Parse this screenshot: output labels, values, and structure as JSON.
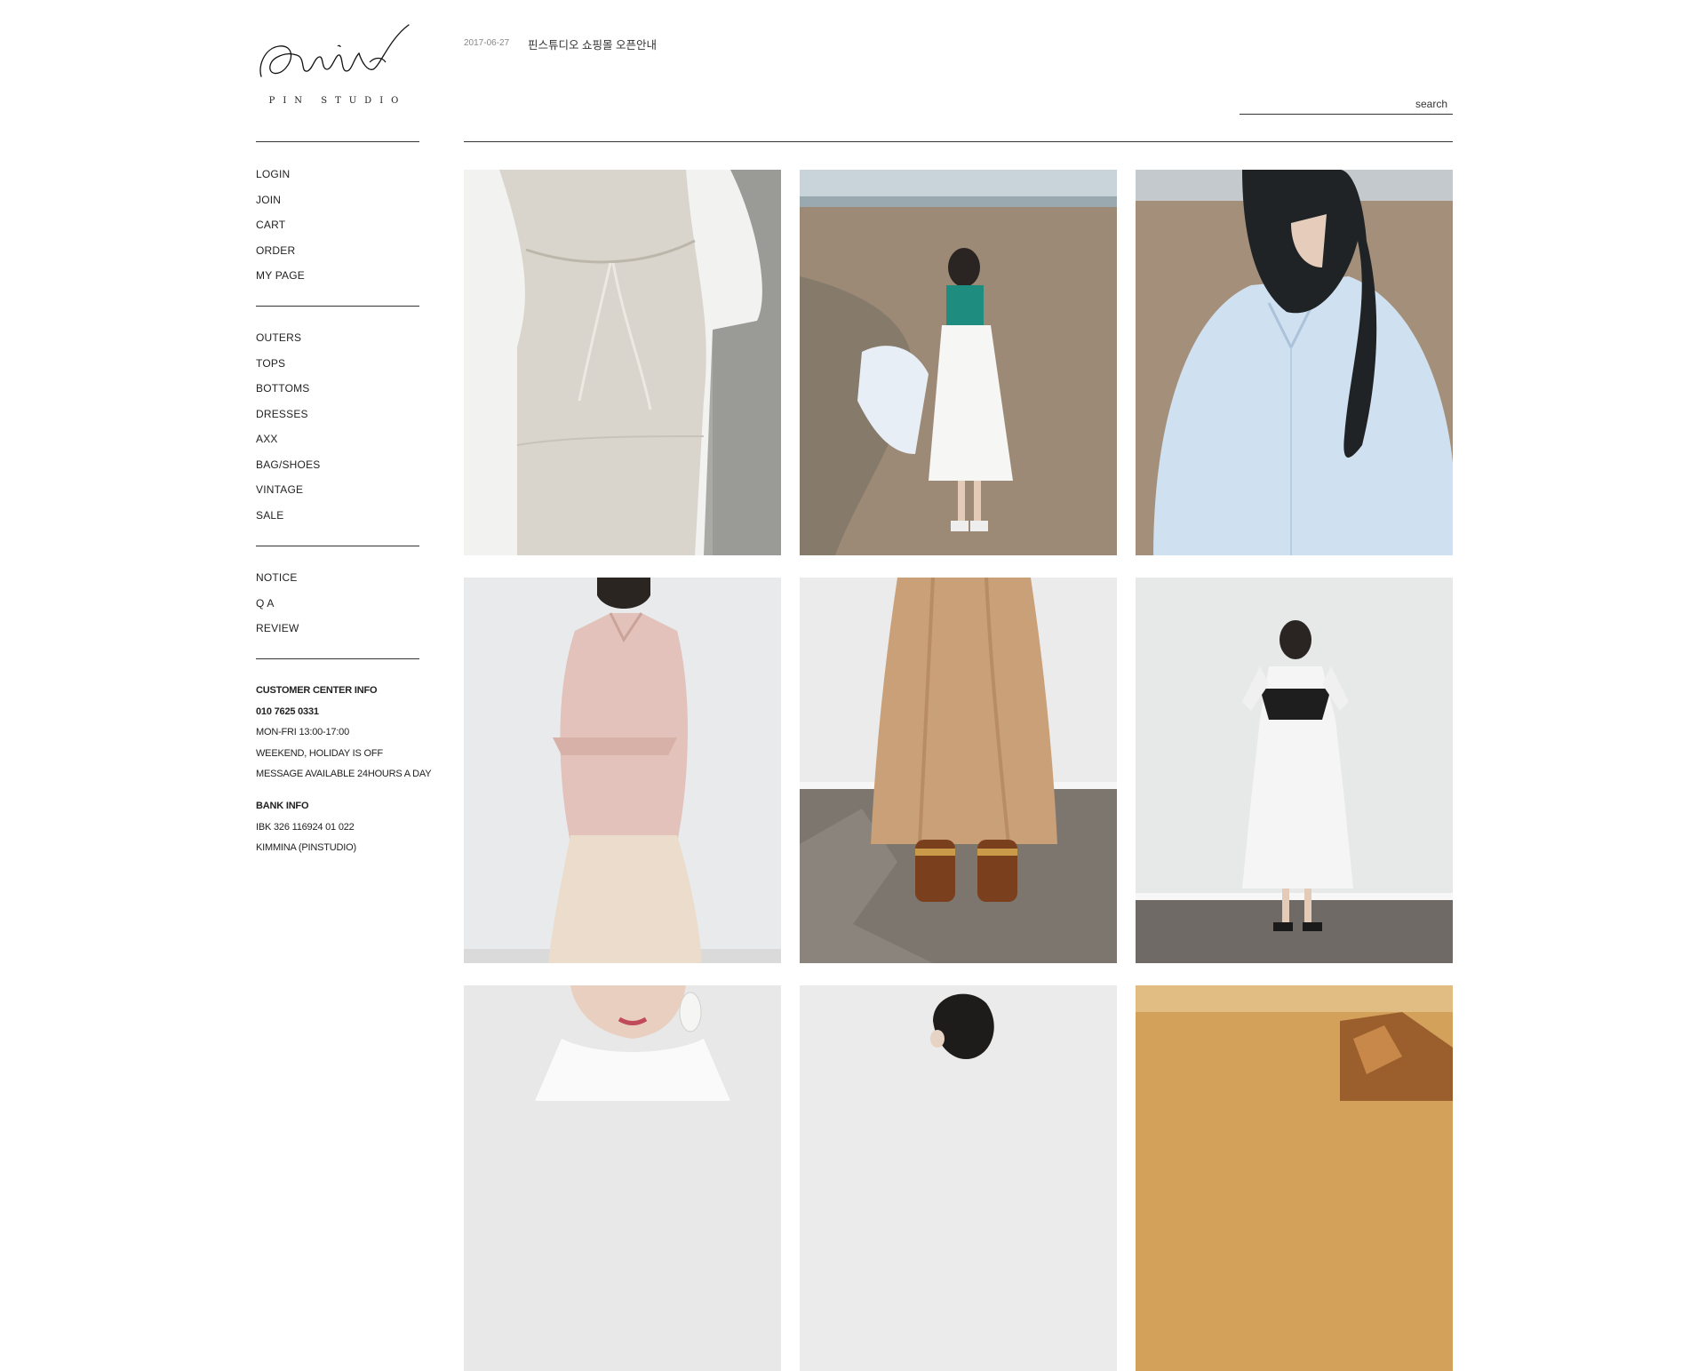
{
  "brand": {
    "script": "Pin",
    "name": "PIN STUDIO"
  },
  "account_menu": [
    "LOGIN",
    "JOIN",
    "CART",
    "ORDER",
    "MY PAGE"
  ],
  "category_menu": [
    "OUTERS",
    "TOPS",
    "BOTTOMS",
    "DRESSES",
    "AXX",
    "BAG/SHOES",
    "VINTAGE",
    "SALE"
  ],
  "board_menu": [
    "NOTICE",
    "Q A",
    "REVIEW"
  ],
  "customer_center": {
    "heading": "CUSTOMER CENTER INFO",
    "phone": "010 7625 0331",
    "hours": "MON-FRI 13:00-17:00",
    "holiday": "WEEKEND, HOLIDAY IS OFF",
    "message": "MESSAGE AVAILABLE 24HOURS A DAY"
  },
  "bank": {
    "heading": "BANK INFO",
    "account": "IBK 326 116924 01 022",
    "holder": "KIMMINA (PINSTUDIO)"
  },
  "notice": {
    "date": "2017-06-27",
    "title": "핀스튜디오 쇼핑몰 오픈안내"
  },
  "search": {
    "placeholder": "search"
  },
  "colors": {
    "rule": "#333333",
    "text": "#222222",
    "muted": "#888888"
  }
}
